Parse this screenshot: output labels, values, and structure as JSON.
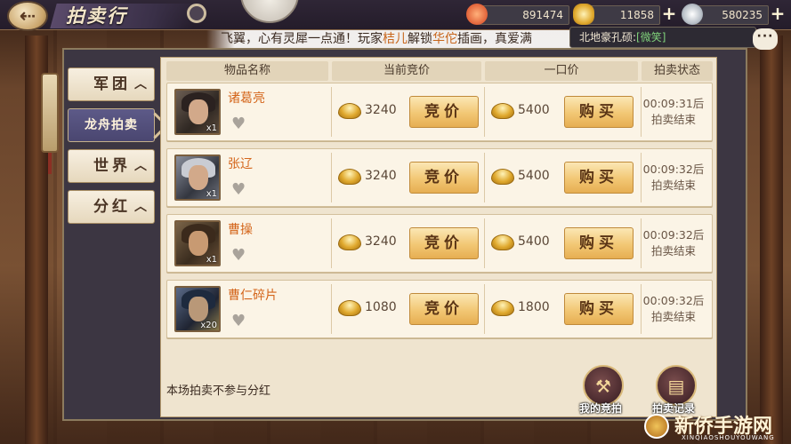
{
  "header": {
    "title": "拍卖行",
    "currencies": [
      {
        "name": "stamina",
        "icon": "flame-token-icon",
        "value": "891474"
      },
      {
        "name": "ingot",
        "icon": "gold-ingot-icon",
        "value": "11858"
      },
      {
        "name": "silver",
        "icon": "silver-coin-icon",
        "value": "580235"
      }
    ]
  },
  "marquee": {
    "prefix": "飞翼，心有灵犀一点通！玩家",
    "player": "桔儿",
    "mid": "解锁",
    "hero": "华佗",
    "suffix": "插画，真爱满"
  },
  "chat": {
    "speaker": "北地豪孔硕:",
    "emote": "[微笑]"
  },
  "tabs": [
    {
      "label": "军团",
      "chev": "︿",
      "active": false
    },
    {
      "label": "龙舟拍卖",
      "chev": "",
      "active": true
    },
    {
      "label": "世界",
      "chev": "︿",
      "active": false
    },
    {
      "label": "分红",
      "chev": "︿",
      "active": false
    }
  ],
  "table": {
    "headers": [
      "物品名称",
      "当前竞价",
      "一口价",
      "拍卖状态"
    ],
    "bid_label": "竞价",
    "buy_label": "购买",
    "rows": [
      {
        "name": "诸葛亮",
        "qty": "x1",
        "bid": "3240",
        "buyout": "5400",
        "time": "00:09:31后",
        "status": "拍卖结束"
      },
      {
        "name": "张辽",
        "qty": "x1",
        "bid": "3240",
        "buyout": "5400",
        "time": "00:09:32后",
        "status": "拍卖结束"
      },
      {
        "name": "曹操",
        "qty": "x1",
        "bid": "3240",
        "buyout": "5400",
        "time": "00:09:32后",
        "status": "拍卖结束"
      },
      {
        "name": "曹仁碎片",
        "qty": "x20",
        "bid": "1080",
        "buyout": "1800",
        "time": "00:09:32后",
        "status": "拍卖结束"
      }
    ]
  },
  "footer": {
    "note": "本场拍卖不参与分红",
    "my_bids_label": "我的竞拍",
    "records_label": "拍卖记录"
  },
  "watermark": {
    "text": "新侨手游网",
    "sub": "XINQIAOSHOUYOUWANG"
  },
  "colors": {
    "accent_orange": "#d4661c",
    "button_gold": "#f2c774",
    "active_tab": "#4a4670"
  }
}
